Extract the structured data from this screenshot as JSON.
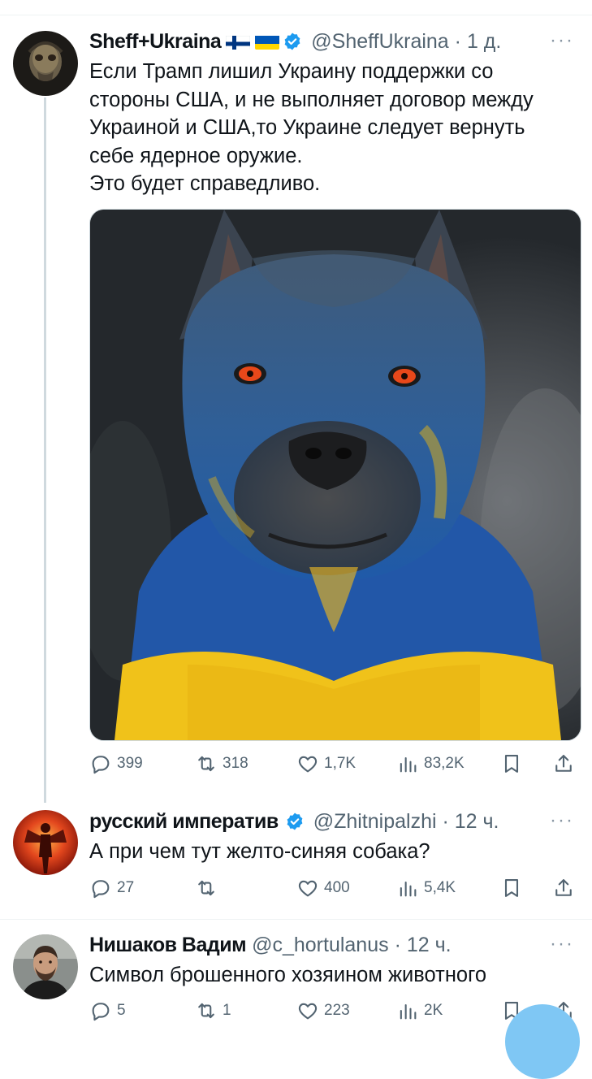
{
  "tweet": {
    "name": "Sheff+Ukraina",
    "handle": "@SheffUkraina",
    "time": "· 1 д.",
    "text": "Если Трамп лишил Украину поддержки со\nстороны США, и не выполняет договор между\nУкраиной и США,то Украине следует вернуть\nсебе ядерное оружие.\n Это будет справедливо.",
    "stats": {
      "replies": "399",
      "retweets": "318",
      "likes": "1,7K",
      "views": "83,2K"
    }
  },
  "replies": [
    {
      "name": "русский императив",
      "handle": "@Zhitnipalzhi",
      "time": "· 12 ч.",
      "text": "А при чем тут желто-синяя собака?",
      "stats": {
        "replies": "27",
        "retweets": "",
        "likes": "400",
        "views": "5,4K"
      }
    },
    {
      "name": "Нишаков Вадим",
      "handle": "@c_hortulanus",
      "time": "· 12 ч.",
      "text": "Символ брошенного хозяином животного",
      "stats": {
        "replies": "5",
        "retweets": "1",
        "likes": "223",
        "views": "2K"
      }
    }
  ],
  "ui": {
    "more": "···"
  },
  "icons": [
    "finland-flag-icon",
    "ukraine-flag-icon",
    "verified-badge-icon",
    "reply-icon",
    "retweet-icon",
    "like-icon",
    "views-icon",
    "bookmark-icon",
    "share-icon"
  ],
  "colors": {
    "verified": "#1d9bf0",
    "muted": "#536471",
    "flag_blue": "#0057b7",
    "flag_yellow": "#ffd700"
  }
}
